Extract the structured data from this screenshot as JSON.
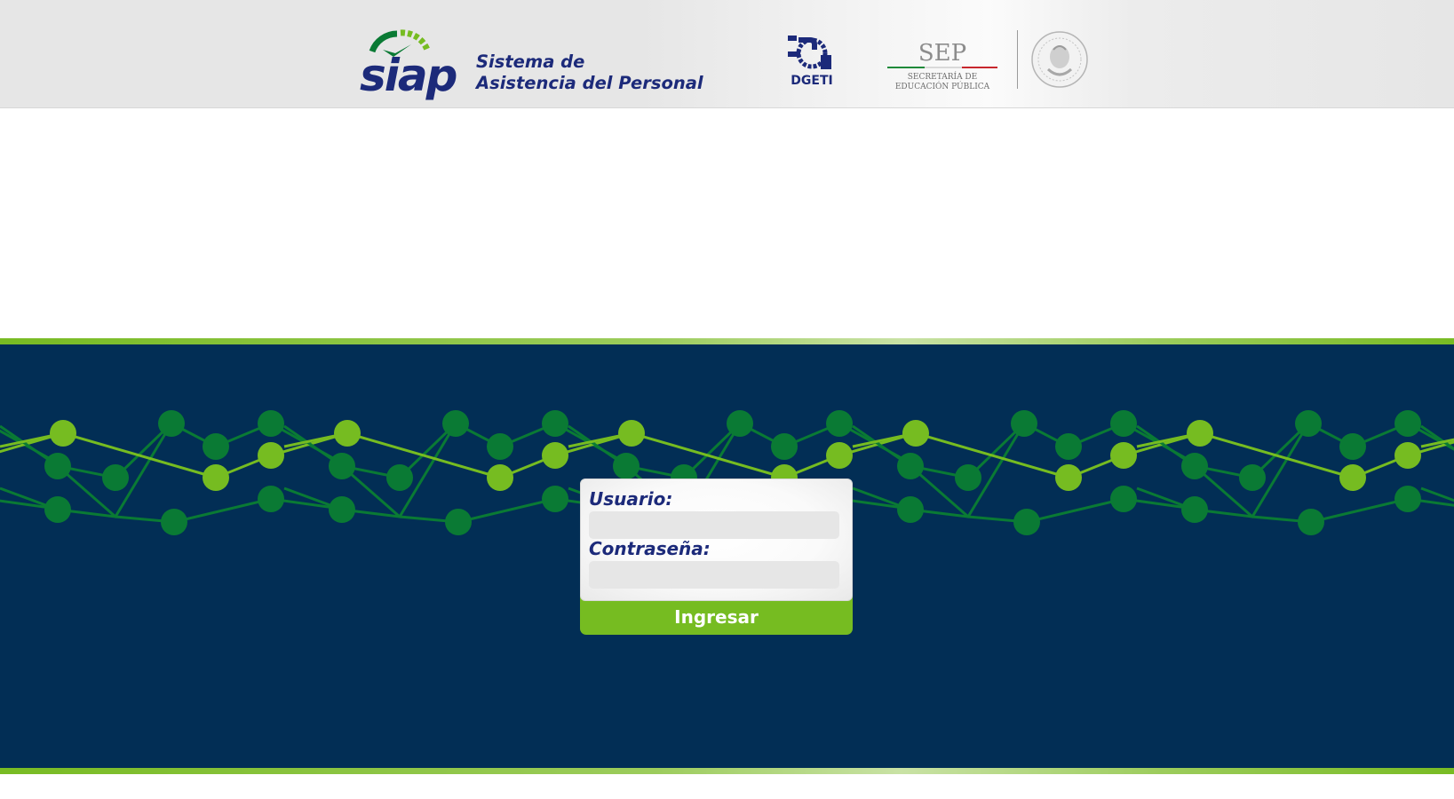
{
  "header": {
    "logo_text": "siap",
    "subtitle_line1": "Sistema de",
    "subtitle_line2": "Asistencia del Personal",
    "dgeti_text": "DGETI",
    "sep_title": "SEP",
    "sep_line1": "SECRETARÍA DE",
    "sep_line2": "EDUCACIÓN PÚBLICA"
  },
  "login": {
    "username_label": "Usuario:",
    "username_value": "",
    "password_label": "Contraseña:",
    "password_value": "",
    "submit_label": "Ingresar"
  },
  "colors": {
    "navy_band": "#022e55",
    "accent_green": "#76bc21",
    "dark_green": "#0a7a34",
    "title_blue": "#1c2a7a"
  }
}
